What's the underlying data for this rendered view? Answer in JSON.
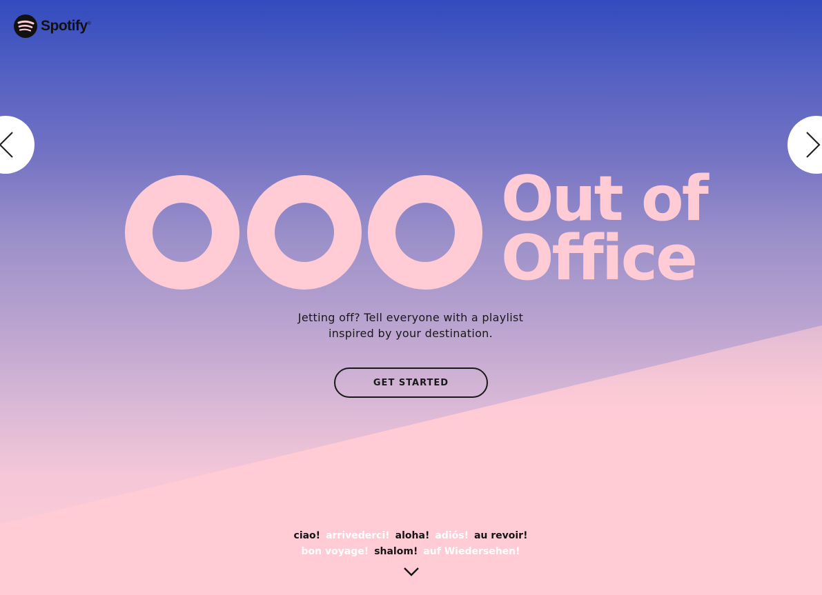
{
  "brand": {
    "name": "Spotify",
    "trademark": "®",
    "icon": "spotify-logo-icon"
  },
  "navigation": {
    "prev_icon": "chevron-left-icon",
    "next_icon": "chevron-right-icon"
  },
  "hero": {
    "title_line1": "Out of",
    "title_line2": "Office",
    "subtitle_line1": "Jetting off? Tell everyone with a playlist",
    "subtitle_line2": "inspired by your destination.",
    "cta_label": "GET STARTED"
  },
  "greetings": {
    "line1": [
      {
        "text": "ciao!",
        "tone": "dark"
      },
      {
        "text": "arrivederci!",
        "tone": "light"
      },
      {
        "text": "aloha!",
        "tone": "dark"
      },
      {
        "text": "adiós!",
        "tone": "light"
      },
      {
        "text": "au revoir!",
        "tone": "dark"
      }
    ],
    "line2": [
      {
        "text": "bon voyage!",
        "tone": "light"
      },
      {
        "text": "shalom!",
        "tone": "dark"
      },
      {
        "text": "auf Wiedersehen!",
        "tone": "light"
      }
    ],
    "scroll_icon": "chevron-down-icon"
  },
  "colors": {
    "top_blue": "#324bbe",
    "pink": "#ffccd5",
    "text_dark": "#181818",
    "white": "#ffffff"
  }
}
